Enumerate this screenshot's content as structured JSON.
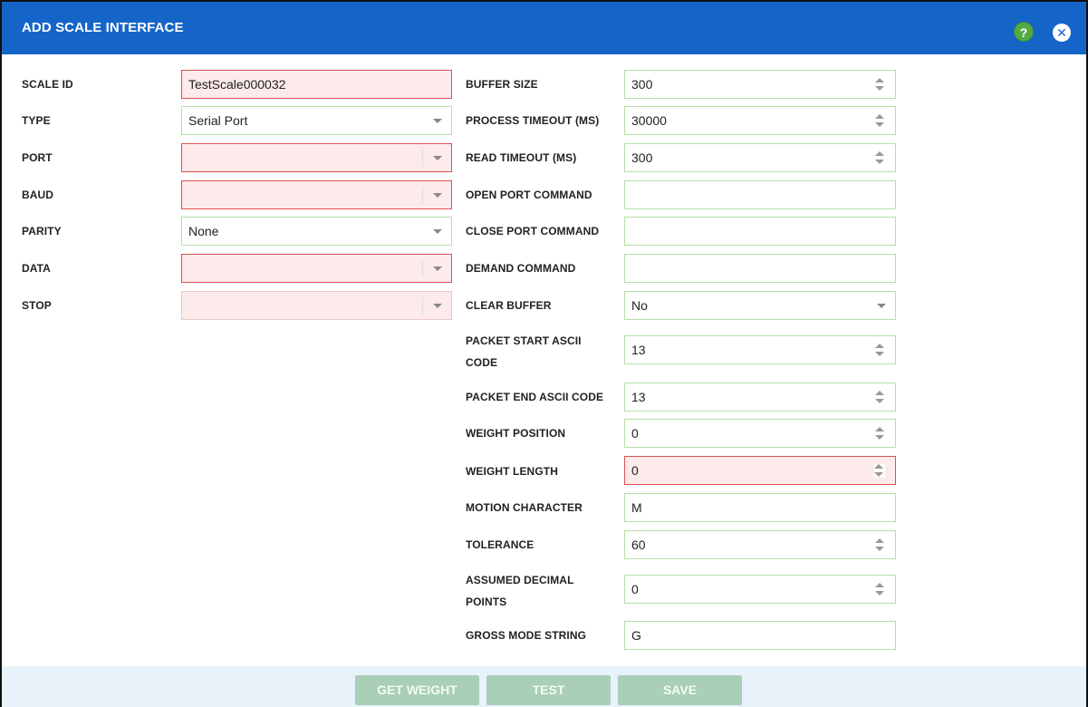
{
  "dialog": {
    "title": "ADD SCALE INTERFACE"
  },
  "icons": {
    "help": "help-icon",
    "close": "close-icon",
    "help_glyph": "?",
    "close_glyph": "✕"
  },
  "left": {
    "scale_id": {
      "label": "SCALE ID",
      "value": "TestScale000032"
    },
    "type": {
      "label": "TYPE",
      "value": "Serial Port"
    },
    "port": {
      "label": "PORT",
      "value": ""
    },
    "baud": {
      "label": "BAUD",
      "value": ""
    },
    "parity": {
      "label": "PARITY",
      "value": "None"
    },
    "data": {
      "label": "DATA",
      "value": ""
    },
    "stop": {
      "label": "STOP",
      "value": ""
    }
  },
  "right": {
    "buffer_size": {
      "label": "BUFFER SIZE",
      "value": "300"
    },
    "process_timeout": {
      "label": "PROCESS TIMEOUT (MS)",
      "value": "30000"
    },
    "read_timeout": {
      "label": "READ TIMEOUT (MS)",
      "value": "300"
    },
    "open_port_command": {
      "label": "OPEN PORT COMMAND",
      "value": ""
    },
    "close_port_command": {
      "label": "CLOSE PORT COMMAND",
      "value": ""
    },
    "demand_command": {
      "label": "DEMAND COMMAND",
      "value": ""
    },
    "clear_buffer": {
      "label": "CLEAR BUFFER",
      "value": "No"
    },
    "packet_start": {
      "label_line1": "PACKET START ASCII",
      "label_line2": "CODE",
      "value": "13"
    },
    "packet_end": {
      "label": "PACKET END ASCII CODE",
      "value": "13"
    },
    "weight_position": {
      "label": "WEIGHT POSITION",
      "value": "0"
    },
    "weight_length": {
      "label": "WEIGHT LENGTH",
      "value": "0"
    },
    "motion_character": {
      "label": "MOTION CHARACTER",
      "value": "M"
    },
    "tolerance": {
      "label": "TOLERANCE",
      "value": "60"
    },
    "assumed_decimal": {
      "label_line1": "ASSUMED DECIMAL",
      "label_line2": "POINTS",
      "value": "0"
    },
    "gross_mode": {
      "label": "GROSS MODE STRING",
      "value": "G"
    }
  },
  "footer": {
    "get_weight": "GET WEIGHT",
    "test": "TEST",
    "save": "SAVE"
  },
  "colors": {
    "header": "#1565c8",
    "valid_border": "#b5dfa6",
    "error_border": "#d9534f",
    "error_fill": "#fdeaea",
    "button": "#a9cfb6",
    "footer": "#e8f2fb"
  }
}
